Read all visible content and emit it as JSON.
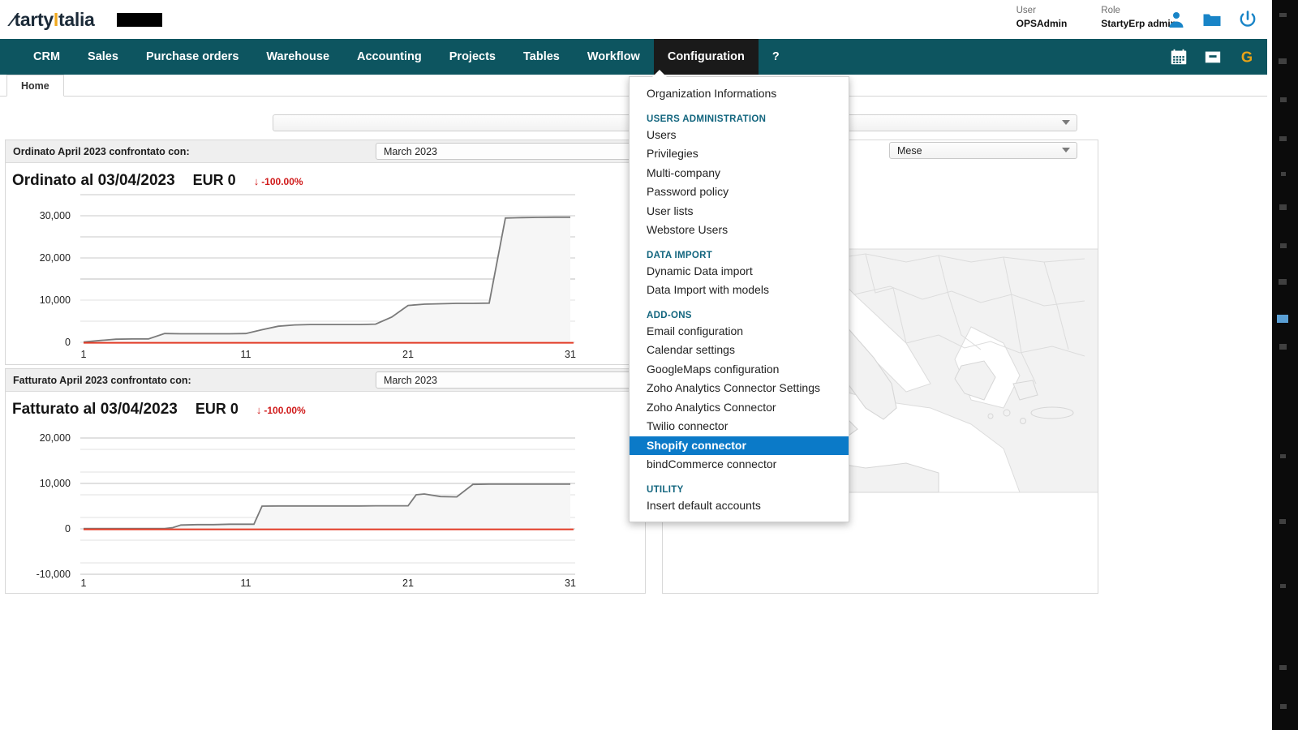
{
  "header": {
    "logo_text_1": "tarty",
    "logo_bar": "I",
    "logo_text_2": "talia",
    "user_label": "User",
    "user_value": "OPSAdmin",
    "role_label": "Role",
    "role_value": "StartyErp admin",
    "icons": [
      "person-icon",
      "folder-icon",
      "power-icon"
    ]
  },
  "nav": {
    "items": [
      {
        "label": "CRM",
        "active": false
      },
      {
        "label": "Sales",
        "active": false
      },
      {
        "label": "Purchase orders",
        "active": false
      },
      {
        "label": "Warehouse",
        "active": false
      },
      {
        "label": "Accounting",
        "active": false
      },
      {
        "label": "Projects",
        "active": false
      },
      {
        "label": "Tables",
        "active": false
      },
      {
        "label": "Workflow",
        "active": false
      },
      {
        "label": "Configuration",
        "active": true
      },
      {
        "label": "?",
        "active": false
      }
    ],
    "right_icons": [
      "calendar-icon",
      "inbox-icon",
      "google-icon"
    ],
    "bg_color": "#0d5560",
    "active_bg_color": "#1a1a1a"
  },
  "tabs": {
    "home_label": "Home"
  },
  "filters": {
    "global_select_value": "",
    "period_select_value": "Mese"
  },
  "panels": [
    {
      "header_title": "Ordinato April 2023 confrontato con:",
      "compare_select_value": "March 2023",
      "kpi_title": "Ordinato al 03/04/2023",
      "kpi_value": "EUR 0",
      "kpi_delta": "-100.00%",
      "kpi_delta_arrow": "↓",
      "kpi_delta_color": "#d01b1b"
    },
    {
      "header_title": "Fatturato April 2023 confrontato con:",
      "compare_select_value": "March 2023",
      "kpi_title": "Fatturato al 03/04/2023",
      "kpi_value": "EUR 0",
      "kpi_delta": "-100.00%",
      "kpi_delta_arrow": "↓",
      "kpi_delta_color": "#d01b1b"
    }
  ],
  "dropdown": {
    "open_for": "Configuration",
    "entries": [
      {
        "type": "item",
        "label": "Organization Informations",
        "selected": false
      },
      {
        "type": "group",
        "label": "USERS ADMINISTRATION"
      },
      {
        "type": "item",
        "label": "Users",
        "selected": false
      },
      {
        "type": "item",
        "label": "Privilegies",
        "selected": false
      },
      {
        "type": "item",
        "label": "Multi-company",
        "selected": false
      },
      {
        "type": "item",
        "label": "Password policy",
        "selected": false
      },
      {
        "type": "item",
        "label": "User lists",
        "selected": false
      },
      {
        "type": "item",
        "label": "Webstore Users",
        "selected": false
      },
      {
        "type": "group",
        "label": "DATA IMPORT"
      },
      {
        "type": "item",
        "label": "Dynamic Data import",
        "selected": false
      },
      {
        "type": "item",
        "label": "Data Import with models",
        "selected": false
      },
      {
        "type": "group",
        "label": "ADD-ONS"
      },
      {
        "type": "item",
        "label": "Email configuration",
        "selected": false
      },
      {
        "type": "item",
        "label": "Calendar settings",
        "selected": false
      },
      {
        "type": "item",
        "label": "GoogleMaps configuration",
        "selected": false
      },
      {
        "type": "item",
        "label": "Zoho Analytics Connector Settings",
        "selected": false
      },
      {
        "type": "item",
        "label": "Zoho Analytics Connector",
        "selected": false
      },
      {
        "type": "item",
        "label": "Twilio connector",
        "selected": false
      },
      {
        "type": "item",
        "label": "Shopify connector",
        "selected": true
      },
      {
        "type": "item",
        "label": "bindCommerce connector",
        "selected": false
      },
      {
        "type": "group",
        "label": "UTILITY"
      },
      {
        "type": "item",
        "label": "Insert default accounts",
        "selected": false
      }
    ],
    "highlight_color": "#0b7ac8",
    "group_color": "#12657e"
  },
  "map": {
    "name": "europe-mediterranean-map",
    "land_color": "#f2f2f2",
    "border_color": "#d8d8d8"
  },
  "chart_data": [
    {
      "type": "area",
      "title": "Ordinato al 03/04/2023",
      "xlabel": "",
      "ylabel": "",
      "xticks": [
        "1",
        "11",
        "21",
        "31"
      ],
      "yticks": [
        "0",
        "10,000",
        "20,000",
        "30,000"
      ],
      "ylim": [
        0,
        33000
      ],
      "xlim": [
        1,
        31
      ],
      "grid": true,
      "series": [
        {
          "name": "March 2023",
          "color": "#7a7a7a",
          "fill": "#f6f6f6",
          "x": [
            1,
            2,
            3,
            4,
            5,
            6,
            7,
            8,
            9,
            10,
            11,
            12,
            13,
            14,
            15,
            16,
            17,
            18,
            19,
            20,
            21,
            22,
            23,
            24,
            25,
            26,
            27,
            28,
            29,
            30,
            31
          ],
          "values": [
            150,
            500,
            900,
            1000,
            1000,
            2300,
            2250,
            2250,
            2250,
            2250,
            2300,
            3200,
            4000,
            4300,
            4400,
            4400,
            4400,
            4400,
            4500,
            6200,
            8900,
            9200,
            9300,
            9400,
            9400,
            9450,
            29500,
            29600,
            29650,
            29700,
            29700
          ]
        },
        {
          "name": "April 2023",
          "color": "#e23b26",
          "fill": "none",
          "x": [
            1,
            31
          ],
          "values": [
            0,
            0
          ]
        }
      ]
    },
    {
      "type": "area",
      "title": "Fatturato al 03/04/2023",
      "xlabel": "",
      "ylabel": "",
      "xticks": [
        "1",
        "11",
        "21",
        "31"
      ],
      "yticks": [
        "-10,000",
        "0",
        "10,000",
        "20,000"
      ],
      "ylim": [
        -10000,
        23000
      ],
      "xlim": [
        1,
        31
      ],
      "grid": true,
      "series": [
        {
          "name": "March 2023",
          "color": "#7a7a7a",
          "fill": "#f6f6f6",
          "x": [
            1,
            2,
            3,
            4,
            5,
            6,
            7,
            8,
            9,
            10,
            11,
            12,
            13,
            14,
            15,
            16,
            17,
            18,
            19,
            20,
            21,
            22,
            23,
            24,
            25,
            26,
            27,
            28,
            29,
            30,
            31
          ],
          "values": [
            100,
            100,
            100,
            100,
            100,
            100,
            200,
            900,
            1000,
            1000,
            1100,
            1100,
            5000,
            5050,
            5050,
            5050,
            5050,
            5050,
            5050,
            5100,
            5100,
            8200,
            7600,
            7500,
            10900,
            11000,
            11000,
            11000,
            11000,
            11000,
            11000
          ]
        },
        {
          "name": "April 2023",
          "color": "#e23b26",
          "fill": "none",
          "x": [
            1,
            31
          ],
          "values": [
            0,
            0
          ]
        }
      ]
    }
  ]
}
